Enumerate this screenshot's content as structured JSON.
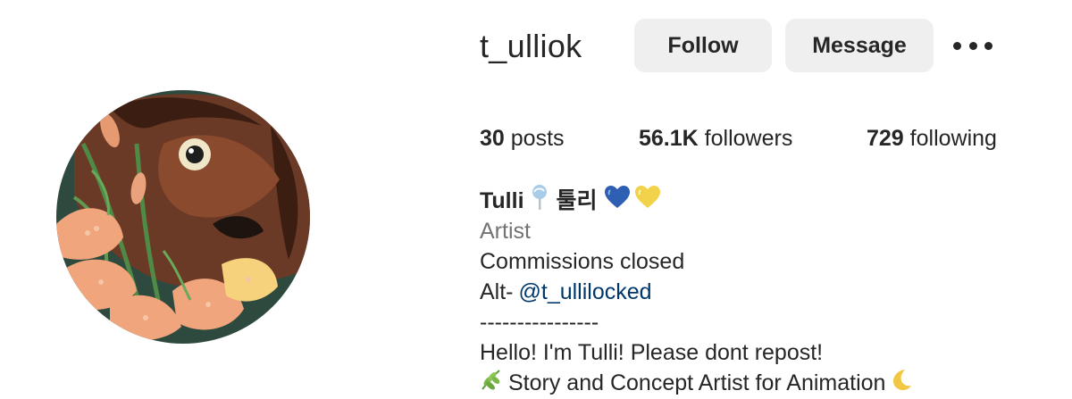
{
  "profile": {
    "username": "t_ulliok",
    "follow_label": "Follow",
    "message_label": "Message"
  },
  "stats": {
    "posts_count": "30",
    "posts_label": "posts",
    "followers_count": "56.1K",
    "followers_label": "followers",
    "following_count": "729",
    "following_label": "following"
  },
  "bio": {
    "name": "Tulli",
    "korean_name": "툴리",
    "category": "Artist",
    "commissions": "Commissions closed",
    "alt_prefix": "Alt-",
    "alt_handle": "@t_ullilocked",
    "divider": "----------------",
    "greeting": "Hello! I'm Tulli! Please dont repost!",
    "role": "Story and Concept Artist for Animation"
  },
  "colors": {
    "button_bg": "#efefef",
    "text": "#262626",
    "secondary_text": "#737373",
    "link": "#00376b",
    "heart_blue": "#2f5fb3",
    "heart_yellow": "#f2d14b"
  },
  "icons": [
    "lollipop-icon",
    "blue-heart-icon",
    "yellow-heart-icon",
    "more-options-icon",
    "herb-icon",
    "crescent-moon-icon"
  ]
}
